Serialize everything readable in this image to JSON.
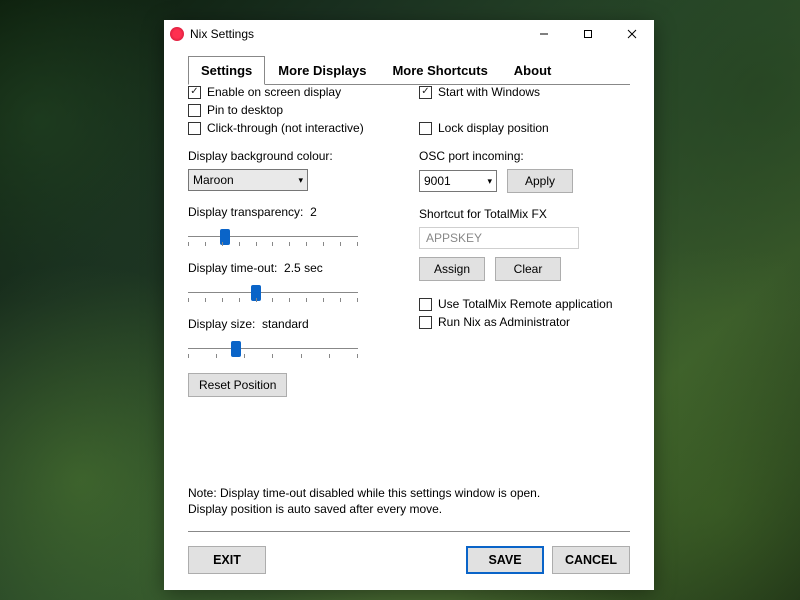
{
  "window": {
    "title": "Nix Settings"
  },
  "tabs": {
    "settings": "Settings",
    "more_displays": "More Displays",
    "more_shortcuts": "More Shortcuts",
    "about": "About"
  },
  "left": {
    "enable_osd": {
      "label": "Enable on screen display",
      "checked": true
    },
    "pin_desktop": {
      "label": "Pin to desktop",
      "checked": false
    },
    "click_through": {
      "label": "Click-through (not interactive)",
      "checked": false
    },
    "bg_colour_label": "Display background colour:",
    "bg_colour_value": "Maroon",
    "transparency_label": "Display transparency:",
    "transparency_value": "2",
    "transparency_pct": 22,
    "timeout_label": "Display time-out:",
    "timeout_value": "2.5 sec",
    "timeout_pct": 40,
    "size_label": "Display size:",
    "size_value": "standard",
    "size_pct": 28,
    "reset_btn": "Reset Position"
  },
  "right": {
    "start_windows": {
      "label": "Start with Windows",
      "checked": true
    },
    "lock_position": {
      "label": "Lock display position",
      "checked": false
    },
    "osc_label": "OSC port incoming:",
    "osc_value": "9001",
    "apply_btn": "Apply",
    "shortcut_label": "Shortcut for TotalMix FX",
    "shortcut_value": "APPSKEY",
    "assign_btn": "Assign",
    "clear_btn": "Clear",
    "use_remote": {
      "label": "Use TotalMix Remote application",
      "checked": false
    },
    "run_admin": {
      "label": "Run Nix as Administrator",
      "checked": false
    }
  },
  "note_line1": "Note: Display time-out disabled while this settings window is open.",
  "note_line2": "Display position is auto saved after every move.",
  "footer": {
    "exit": "EXIT",
    "save": "SAVE",
    "cancel": "CANCEL"
  }
}
